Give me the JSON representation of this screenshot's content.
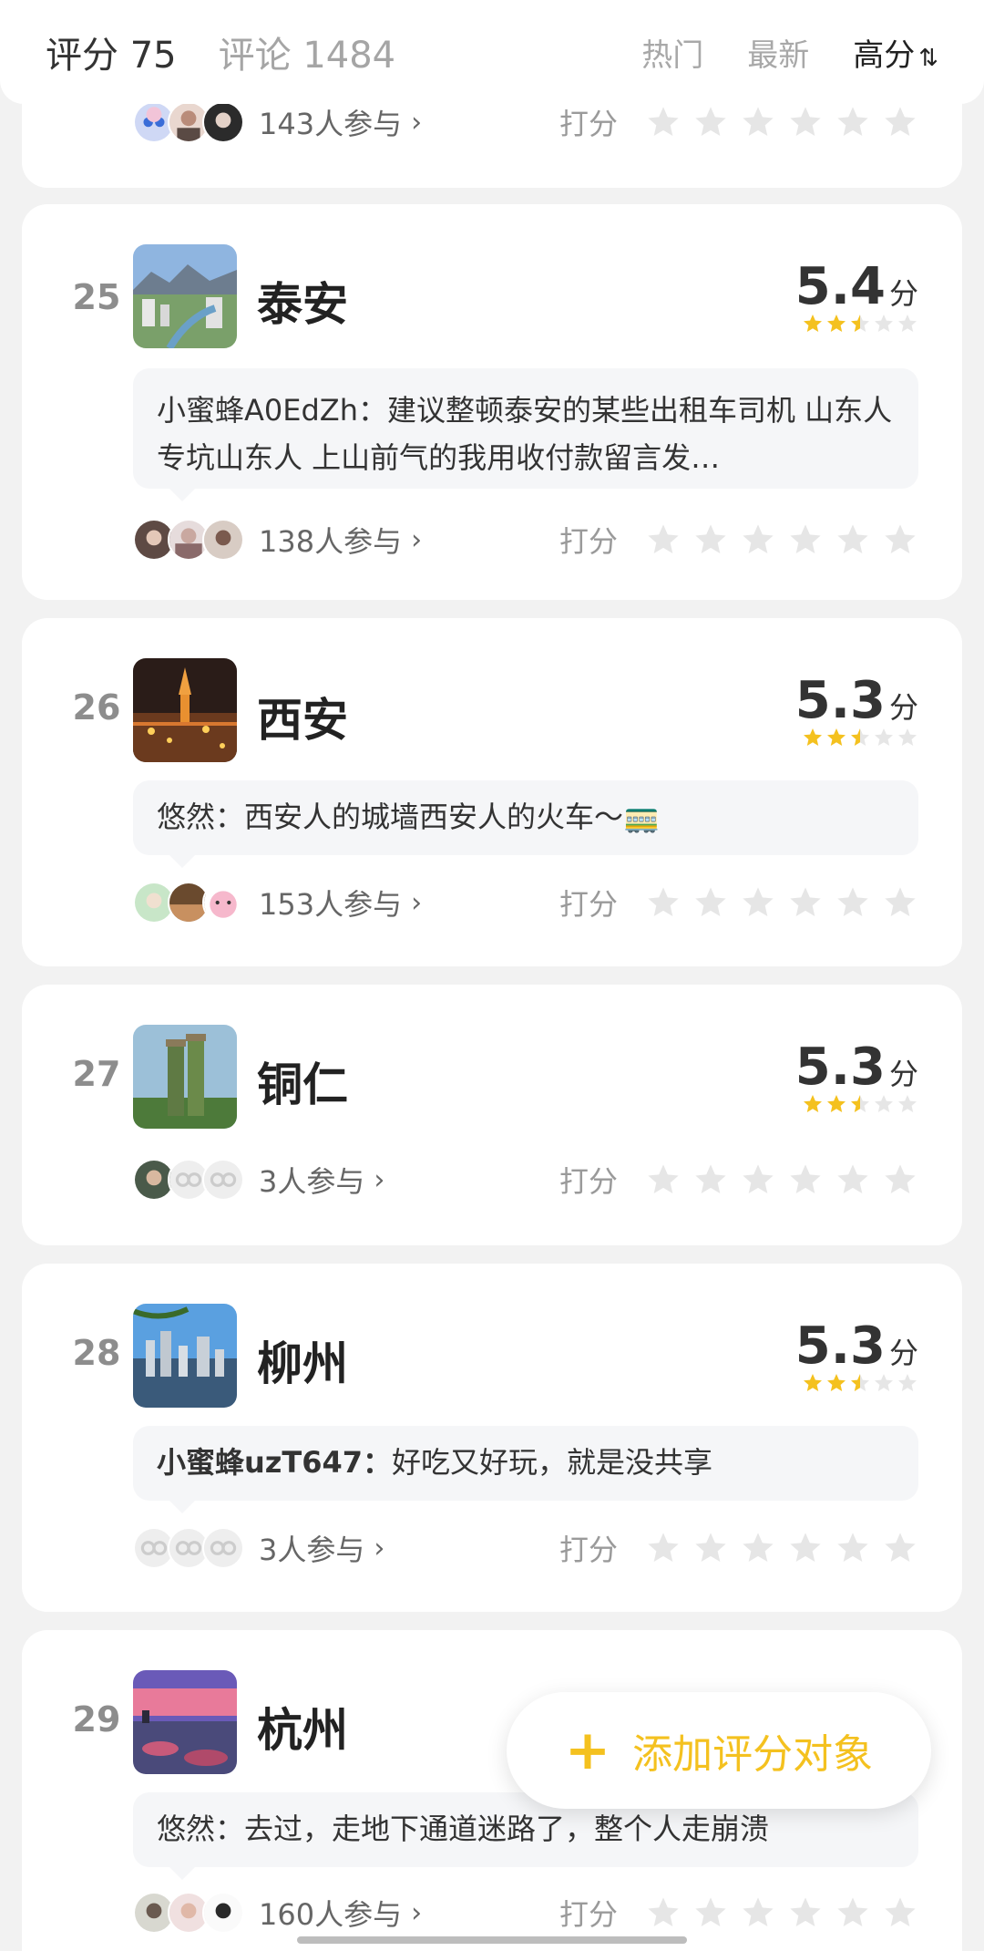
{
  "header": {
    "score_label": "评分 75",
    "comments_label": "评论 1484",
    "tabs": [
      "热门",
      "最新",
      "高分"
    ],
    "sort_icon": "sort-arrows-icon"
  },
  "partial_card": {
    "participants": "143人参与",
    "rate_label": "打分"
  },
  "items": [
    {
      "rank": "25",
      "name": "泰安",
      "score": "5.4",
      "unit": "分",
      "stars": 2.5,
      "comment_author": "小蜜蜂A0EdZh：",
      "comment_text": "建议整顿泰安的某些出租车司机 山东人专坑山东人 上山前气的我用收付款留言发…",
      "participants": "138人参与",
      "rate_label": "打分"
    },
    {
      "rank": "26",
      "name": "西安",
      "score": "5.3",
      "unit": "分",
      "stars": 2.5,
      "comment_author": "悠然：",
      "comment_text": "西安人的城墙西安人的火车～🚃",
      "participants": "153人参与",
      "rate_label": "打分"
    },
    {
      "rank": "27",
      "name": "铜仁",
      "score": "5.3",
      "unit": "分",
      "stars": 2.5,
      "participants": "3人参与",
      "rate_label": "打分"
    },
    {
      "rank": "28",
      "name": "柳州",
      "score": "5.3",
      "unit": "分",
      "stars": 2.5,
      "comment_author": "小蜜蜂uzT647：",
      "comment_text": "好吃又好玩，就是没共享",
      "participants": "3人参与",
      "rate_label": "打分"
    },
    {
      "rank": "29",
      "name": "杭州",
      "comment_author": "悠然：",
      "comment_text": "去过，走地下通道迷路了，整个人走崩溃",
      "participants": "160人参与",
      "rate_label": "打分"
    }
  ],
  "fab": {
    "plus": "+",
    "label": "添加评分对象"
  },
  "colors": {
    "accent": "#f4c11f",
    "star_empty": "#e6e6e6"
  }
}
